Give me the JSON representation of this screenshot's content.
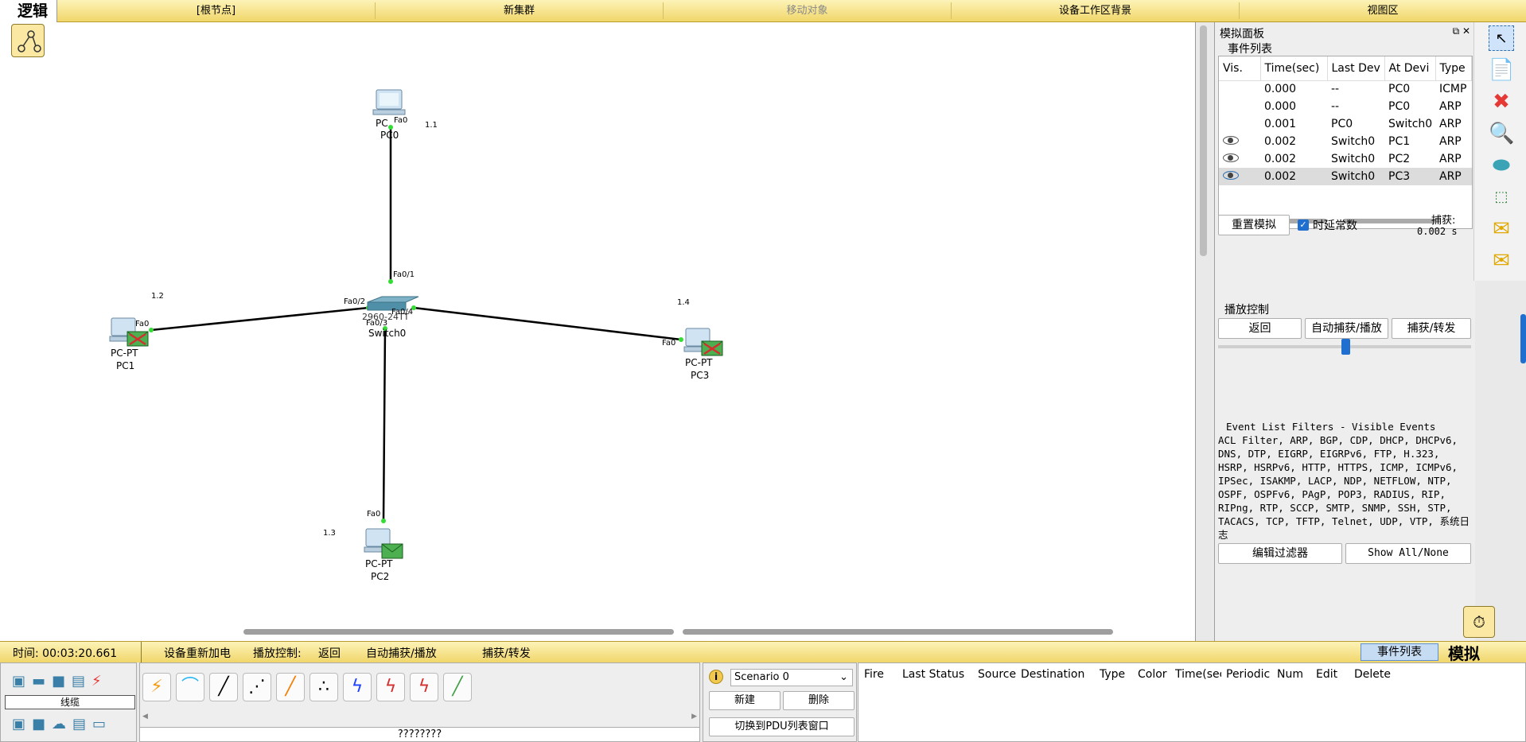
{
  "topbar": {
    "mode": "逻辑",
    "root_node": "[根节点]",
    "new_cluster": "新集群",
    "move_object": "移动对象",
    "background": "设备工作区背景",
    "viewport": "视图区"
  },
  "devices": {
    "pc0": {
      "model": "PC",
      "name": "PC0",
      "port": "Fa0",
      "ip": "1.1"
    },
    "pc1": {
      "model": "PC-PT",
      "name": "PC1",
      "port": "Fa0",
      "ip": "1.2"
    },
    "pc2": {
      "model": "PC-PT",
      "name": "PC2",
      "port": "Fa0",
      "ip": "1.3"
    },
    "pc3": {
      "model": "PC-PT",
      "name": "PC3",
      "port": "Fa0",
      "ip": "1.4"
    },
    "switch0": {
      "model": "2960-24TT",
      "name": "Switch0",
      "ports": {
        "p1": "Fa0/1",
        "p2": "Fa0/2",
        "p3": "Fa0/3",
        "p4": "Fa0/4"
      }
    }
  },
  "sim_panel": {
    "title": "模拟面板",
    "event_list_label": "事件列表",
    "columns": [
      "Vis.",
      "Time(sec)",
      "Last Dev",
      "At Devi",
      "Type"
    ],
    "events": [
      {
        "time": "0.000",
        "last": "--",
        "at": "PC0",
        "type": "ICMP"
      },
      {
        "time": "0.000",
        "last": "--",
        "at": "PC0",
        "type": "ARP"
      },
      {
        "time": "0.001",
        "last": "PC0",
        "at": "Switch0",
        "type": "ARP"
      },
      {
        "time": "0.002",
        "last": "Switch0",
        "at": "PC1",
        "type": "ARP"
      },
      {
        "time": "0.002",
        "last": "Switch0",
        "at": "PC2",
        "type": "ARP"
      },
      {
        "time": "0.002",
        "last": "Switch0",
        "at": "PC3",
        "type": "ARP"
      }
    ],
    "reset_button": "重置模拟",
    "constant_delay": "时延常数",
    "capture_label": "捕获:",
    "capture_time": "0.002 s",
    "playback_label": "播放控制",
    "back_button": "返回",
    "auto_button": "自动捕获/播放",
    "capture_button": "捕获/转发",
    "filters_title": "Event List Filters - Visible Events",
    "filters_text": "ACL Filter, ARP, BGP, CDP, DHCP, DHCPv6, DNS, DTP, EIGRP, EIGRPv6, FTP, H.323, HSRP, HSRPv6, HTTP, HTTPS, ICMP, ICMPv6, IPSec, ISAKMP, LACP, NDP, NETFLOW, NTP, OSPF, OSPFv6, PAgP, POP3, RADIUS, RIP, RIPng, RTP, SCCP, SMTP, SNMP, SSH, STP, TACACS, TCP, TFTP, Telnet, UDP, VTP, 系统日志",
    "edit_filters": "编辑过滤器",
    "show_all": "Show All/None"
  },
  "bottombar": {
    "time": "时间: 00:03:20.661",
    "power_cycle": "设备重新加电",
    "playback": "播放控制:",
    "back": "返回",
    "auto": "自动捕获/播放",
    "capture": "捕获/转发",
    "event_list_tab": "事件列表",
    "mode": "模拟"
  },
  "device_panel": {
    "category_label": "线缆"
  },
  "unknown_label": "????????",
  "scenario": {
    "selected": "Scenario 0",
    "new": "新建",
    "delete": "删除",
    "switch_pdu": "切换到PDU列表窗口"
  },
  "pdu_columns": [
    "Fire",
    "Last Status",
    "Source",
    "Destination",
    "Type",
    "Color",
    "Time(sec",
    "Periodic",
    "Num",
    "Edit",
    "Delete"
  ]
}
